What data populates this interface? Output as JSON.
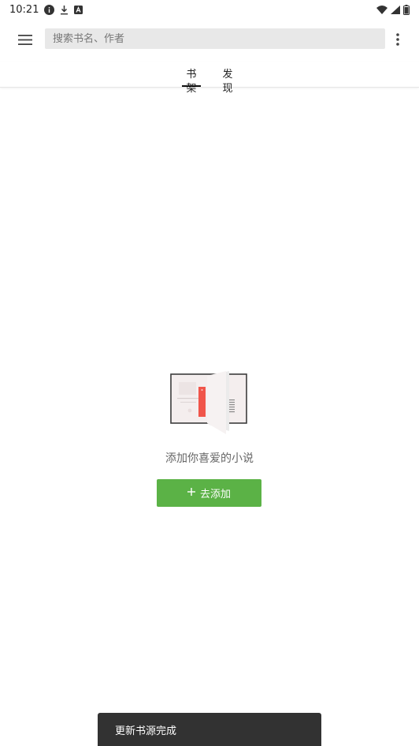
{
  "status_bar": {
    "time": "10:21",
    "icons_left": [
      "info-icon",
      "download-icon",
      "app-icon"
    ],
    "icons_right": [
      "wifi-icon",
      "signal-icon",
      "battery-icon"
    ]
  },
  "toolbar": {
    "menu_icon": "hamburger-menu-icon",
    "search_placeholder": "搜索书名、作者",
    "search_value": "",
    "more_icon": "more-vert-icon"
  },
  "tabs": [
    {
      "label": "书架",
      "active": true
    },
    {
      "label": "发现",
      "active": false
    }
  ],
  "empty_state": {
    "illustration": "open-book-illustration",
    "message": "添加你喜爱的小说",
    "button_label": "去添加",
    "button_icon": "plus-icon"
  },
  "snackbar": {
    "message": "更新书源完成"
  },
  "colors": {
    "accent": "#5bb246",
    "snackbar_bg": "#323232",
    "search_bg": "#e8e8e8",
    "bookmark": "#f0554a"
  }
}
